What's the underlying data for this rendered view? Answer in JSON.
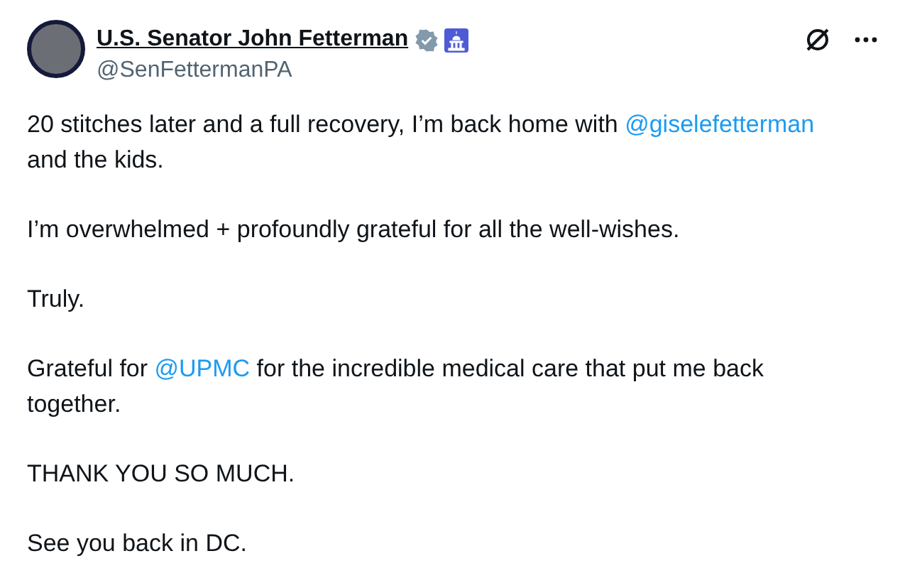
{
  "author": {
    "name": "U.S. Senator John Fetterman",
    "handle": "@SenFettermanPA",
    "verified": true
  },
  "paragraphs": [
    [
      {
        "kind": "text",
        "text": "20 stitches later and a full recovery, I’m back home with "
      },
      {
        "kind": "mention",
        "text": "@giselefetterman"
      },
      {
        "kind": "text",
        "text": " and the kids."
      }
    ],
    [
      {
        "kind": "text",
        "text": "I’m overwhelmed + profoundly grateful for all the well-wishes."
      }
    ],
    [
      {
        "kind": "text",
        "text": "Truly."
      }
    ],
    [
      {
        "kind": "text",
        "text": "Grateful for "
      },
      {
        "kind": "mention",
        "text": "@UPMC"
      },
      {
        "kind": "text",
        "text": " for the incredible medical care that put me back together."
      }
    ],
    [
      {
        "kind": "text",
        "text": "THANK YOU SO MUCH."
      }
    ],
    [
      {
        "kind": "text",
        "text": "See you back in DC."
      }
    ]
  ]
}
